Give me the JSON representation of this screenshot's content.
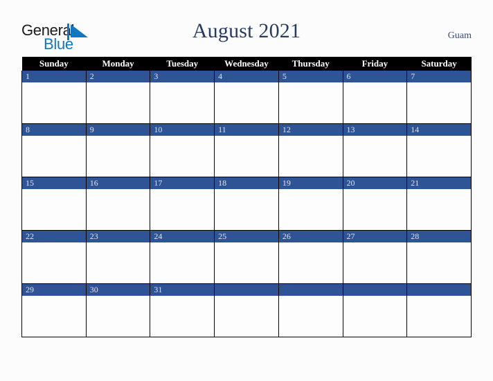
{
  "brand": {
    "name_part1": "General",
    "name_part2": "Blue",
    "mark_icon": "triangle-logo-icon",
    "color_dark": "#1b1b1b",
    "color_blue": "#1277bf"
  },
  "header": {
    "title": "August 2021",
    "locale": "Guam",
    "title_color": "#283a5e",
    "locale_color": "#3d4f78"
  },
  "calendar": {
    "weekday_headers": [
      "Sunday",
      "Monday",
      "Tuesday",
      "Wednesday",
      "Thursday",
      "Friday",
      "Saturday"
    ],
    "header_bg": "#000000",
    "header_text_color": "#ffffff",
    "daybar_bg": "#2f5496",
    "daybar_text_color": "#dfe4ee",
    "cell_bg": "#fdfdfd",
    "border_color": "#000000",
    "weeks": [
      [
        {
          "day": "1",
          "note": ""
        },
        {
          "day": "2",
          "note": ""
        },
        {
          "day": "3",
          "note": ""
        },
        {
          "day": "4",
          "note": ""
        },
        {
          "day": "5",
          "note": ""
        },
        {
          "day": "6",
          "note": ""
        },
        {
          "day": "7",
          "note": ""
        }
      ],
      [
        {
          "day": "8",
          "note": ""
        },
        {
          "day": "9",
          "note": ""
        },
        {
          "day": "10",
          "note": ""
        },
        {
          "day": "11",
          "note": ""
        },
        {
          "day": "12",
          "note": ""
        },
        {
          "day": "13",
          "note": ""
        },
        {
          "day": "14",
          "note": ""
        }
      ],
      [
        {
          "day": "15",
          "note": ""
        },
        {
          "day": "16",
          "note": ""
        },
        {
          "day": "17",
          "note": ""
        },
        {
          "day": "18",
          "note": ""
        },
        {
          "day": "19",
          "note": ""
        },
        {
          "day": "20",
          "note": ""
        },
        {
          "day": "21",
          "note": ""
        }
      ],
      [
        {
          "day": "22",
          "note": ""
        },
        {
          "day": "23",
          "note": ""
        },
        {
          "day": "24",
          "note": ""
        },
        {
          "day": "25",
          "note": ""
        },
        {
          "day": "26",
          "note": ""
        },
        {
          "day": "27",
          "note": ""
        },
        {
          "day": "28",
          "note": ""
        }
      ],
      [
        {
          "day": "29",
          "note": ""
        },
        {
          "day": "30",
          "note": ""
        },
        {
          "day": "31",
          "note": ""
        },
        {
          "day": "",
          "note": ""
        },
        {
          "day": "",
          "note": ""
        },
        {
          "day": "",
          "note": ""
        },
        {
          "day": "",
          "note": ""
        }
      ]
    ]
  }
}
